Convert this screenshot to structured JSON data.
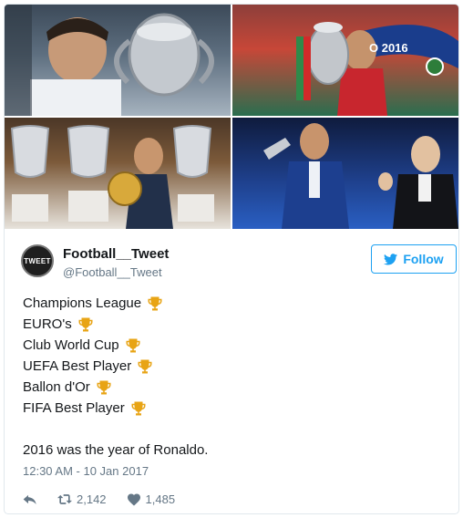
{
  "tweet": {
    "author_name": "Football__Tweet",
    "author_handle": "@Football__Tweet",
    "avatar_text": "TWEET",
    "follow_label": "Follow",
    "lines": [
      "Champions League",
      "EURO's",
      "Club World Cup",
      "UEFA Best Player",
      "Ballon d'Or",
      "FIFA Best Player"
    ],
    "closing_line": "2016 was the year of Ronaldo.",
    "timestamp": "12:30 AM - 10 Jan 2017",
    "retweet_count": "2,142",
    "like_count": "1,485"
  },
  "photos": {
    "euro_banner_text": "O 2016"
  },
  "icons": {
    "trophy": "trophy-icon",
    "twitter_bird": "twitter-bird-icon",
    "reply": "reply-icon",
    "retweet": "retweet-icon",
    "like": "heart-icon"
  },
  "colors": {
    "accent": "#1da1f2",
    "muted": "#657786",
    "border": "#e1e8ed",
    "trophy": "#e8a415"
  }
}
